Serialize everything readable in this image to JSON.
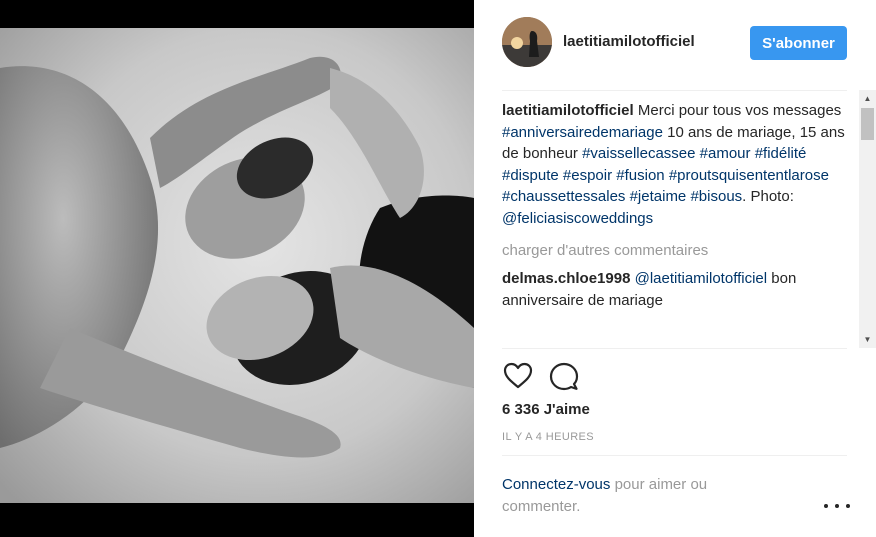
{
  "post": {
    "username": "laetitiamilotofficiel",
    "follow_label": "S'abonner",
    "caption": {
      "username": "laetitiamilotofficiel",
      "parts": [
        {
          "text": "Merci pour tous vos messages ",
          "tag": false
        },
        {
          "text": "#anniversairedemariage",
          "tag": true
        },
        {
          "text": " 10 ans de mariage, 15 ans de bonheur ",
          "tag": false
        },
        {
          "text": "#vaissellecassee",
          "tag": true
        },
        {
          "text": " ",
          "tag": false
        },
        {
          "text": "#amour",
          "tag": true
        },
        {
          "text": " ",
          "tag": false
        },
        {
          "text": "#fidélité",
          "tag": true
        },
        {
          "text": " ",
          "tag": false
        },
        {
          "text": "#dispute",
          "tag": true
        },
        {
          "text": " ",
          "tag": false
        },
        {
          "text": "#espoir",
          "tag": true
        },
        {
          "text": " ",
          "tag": false
        },
        {
          "text": "#fusion",
          "tag": true
        },
        {
          "text": " ",
          "tag": false
        },
        {
          "text": "#proutsquisententlarose",
          "tag": true
        },
        {
          "text": " ",
          "tag": false
        },
        {
          "text": "#chaussettessales",
          "tag": true
        },
        {
          "text": " ",
          "tag": false
        },
        {
          "text": "#jetaime",
          "tag": true
        },
        {
          "text": " ",
          "tag": false
        },
        {
          "text": "#bisous",
          "tag": true
        },
        {
          "text": ". Photo: ",
          "tag": false
        },
        {
          "text": "@feliciasiscoweddings",
          "tag": true
        }
      ]
    },
    "load_more": "charger d'autres commentaires",
    "comments": [
      {
        "username": "delmas.chloe1998",
        "mention": "@laetitiamilotofficiel",
        "text": " bon anniversaire de mariage"
      }
    ],
    "actions": {
      "like_icon": "heart-icon",
      "comment_icon": "comment-icon"
    },
    "likes": "6 336 J'aime",
    "time": "IL Y A 4 HEURES",
    "login": {
      "link": "Connectez-vous",
      "rest": " pour aimer ou commenter."
    },
    "more_icon": "more-options-icon"
  },
  "colors": {
    "follow_button": "#3897f0",
    "link": "#003569",
    "muted": "#999999",
    "text": "#262626"
  }
}
